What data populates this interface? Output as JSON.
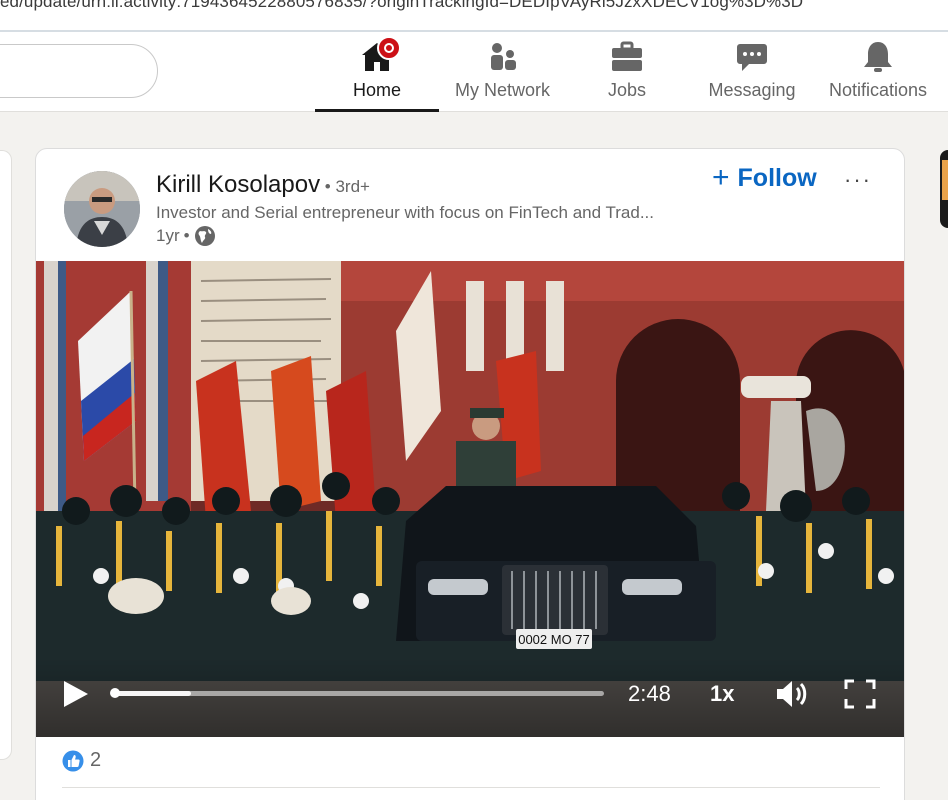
{
  "browser": {
    "url_fragment": "ed/update/urn:li:activity:7194364522880576835/?originTrackingId=DEDIpVAyRi5JzxXDECV1og%3D%3D"
  },
  "nav": {
    "items": [
      {
        "label": "Home",
        "icon": "home-icon",
        "active": true,
        "has_badge": true
      },
      {
        "label": "My Network",
        "icon": "network-icon",
        "active": false
      },
      {
        "label": "Jobs",
        "icon": "briefcase-icon",
        "active": false
      },
      {
        "label": "Messaging",
        "icon": "chat-icon",
        "active": false
      },
      {
        "label": "Notifications",
        "icon": "bell-icon",
        "active": false
      }
    ],
    "accent": "#191919",
    "badge_color": "#cc1016"
  },
  "post": {
    "author_name": "Kirill Kosolapov",
    "degree": " • 3rd+",
    "headline": "Investor and Serial entrepreneur with focus on FinTech and Trad...",
    "time": "1yr",
    "separator": "•",
    "follow_plus": "+",
    "follow_label": "Follow",
    "more_label": "···",
    "follow_color": "#0a66c2"
  },
  "video": {
    "duration": "2:48",
    "speed": "1x",
    "progress_fraction": 0.16,
    "plate_text": "0002 MO 77"
  },
  "reactions": {
    "count": "2",
    "icon": "like-icon"
  }
}
